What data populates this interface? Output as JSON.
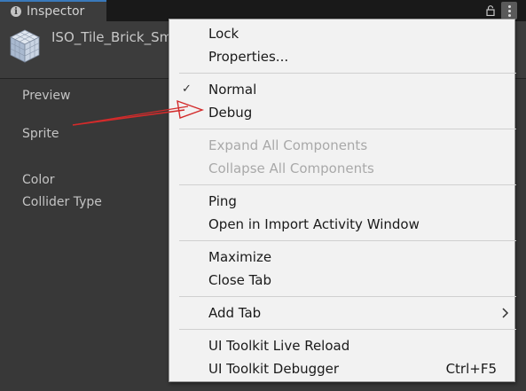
{
  "window": {
    "tab_title": "Inspector",
    "asset_name": "ISO_Tile_Brick_Sm"
  },
  "properties": [
    {
      "label": "Preview"
    },
    {
      "label": "Sprite"
    },
    {
      "label": "Color"
    },
    {
      "label": "Collider Type"
    }
  ],
  "menu": {
    "lock": "Lock",
    "properties": "Properties...",
    "normal": "Normal",
    "normal_checked": true,
    "debug": "Debug",
    "expand_all": "Expand All Components",
    "collapse_all": "Collapse All Components",
    "ping": "Ping",
    "open_import": "Open in Import Activity Window",
    "maximize": "Maximize",
    "close_tab": "Close Tab",
    "add_tab": "Add Tab",
    "live_reload": "UI Toolkit Live Reload",
    "debugger": "UI Toolkit Debugger",
    "debugger_shortcut": "Ctrl+F5"
  },
  "colors": {
    "arrow": "#d32b2b",
    "accent_tab": "#3a79bb"
  },
  "icons": [
    "info-icon",
    "lock-icon",
    "kebab-menu-icon",
    "asset-cube-icon",
    "check-icon",
    "chevron-right-icon"
  ]
}
